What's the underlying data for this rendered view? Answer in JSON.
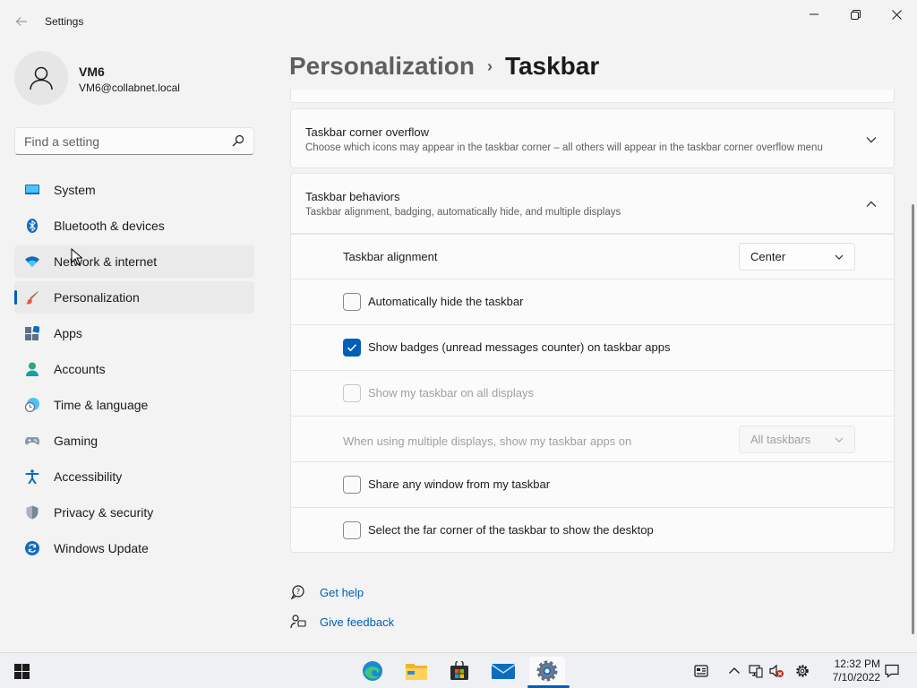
{
  "window": {
    "title": "Settings"
  },
  "account": {
    "name": "VM6",
    "email": "VM6@collabnet.local"
  },
  "search": {
    "placeholder": "Find a setting"
  },
  "sidebar": {
    "items": [
      {
        "label": "System",
        "icon": "system-icon"
      },
      {
        "label": "Bluetooth & devices",
        "icon": "bluetooth-icon"
      },
      {
        "label": "Network & internet",
        "icon": "wifi-icon"
      },
      {
        "label": "Personalization",
        "icon": "brush-icon",
        "active": true
      },
      {
        "label": "Apps",
        "icon": "apps-icon"
      },
      {
        "label": "Accounts",
        "icon": "accounts-icon"
      },
      {
        "label": "Time & language",
        "icon": "clock-globe-icon"
      },
      {
        "label": "Gaming",
        "icon": "gamepad-icon"
      },
      {
        "label": "Accessibility",
        "icon": "accessibility-icon"
      },
      {
        "label": "Privacy & security",
        "icon": "shield-icon"
      },
      {
        "label": "Windows Update",
        "icon": "update-icon"
      }
    ]
  },
  "breadcrumb": {
    "parent": "Personalization",
    "separator": "›",
    "current": "Taskbar"
  },
  "cards": {
    "corner_overflow": {
      "title": "Taskbar corner overflow",
      "description": "Choose which icons may appear in the taskbar corner – all others will appear in the taskbar corner overflow menu"
    },
    "behaviors": {
      "title": "Taskbar behaviors",
      "description": "Taskbar alignment, badging, automatically hide, and multiple displays"
    }
  },
  "behaviors": {
    "alignment": {
      "label": "Taskbar alignment",
      "value": "Center"
    },
    "auto_hide": {
      "label": "Automatically hide the taskbar",
      "checked": false
    },
    "badges": {
      "label": "Show badges (unread messages counter) on taskbar apps",
      "checked": true
    },
    "all_displays": {
      "label": "Show my taskbar on all displays",
      "checked": false,
      "disabled": true
    },
    "multi_display": {
      "label": "When using multiple displays, show my taskbar apps on",
      "value": "All taskbars",
      "disabled": true
    },
    "share_window": {
      "label": "Share any window from my taskbar",
      "checked": false
    },
    "far_corner": {
      "label": "Select the far corner of the taskbar to show the desktop",
      "checked": false
    }
  },
  "links": {
    "help": "Get help",
    "feedback": "Give feedback"
  },
  "taskbar": {
    "apps": [
      "start-icon",
      "edge-icon",
      "file-explorer-icon",
      "store-icon",
      "mail-icon",
      "settings-icon"
    ],
    "time": "12:32 PM",
    "date": "7/10/2022"
  },
  "colors": {
    "accent": "#005fb8",
    "background": "#f3f3f3",
    "card": "#fbfbfb"
  }
}
